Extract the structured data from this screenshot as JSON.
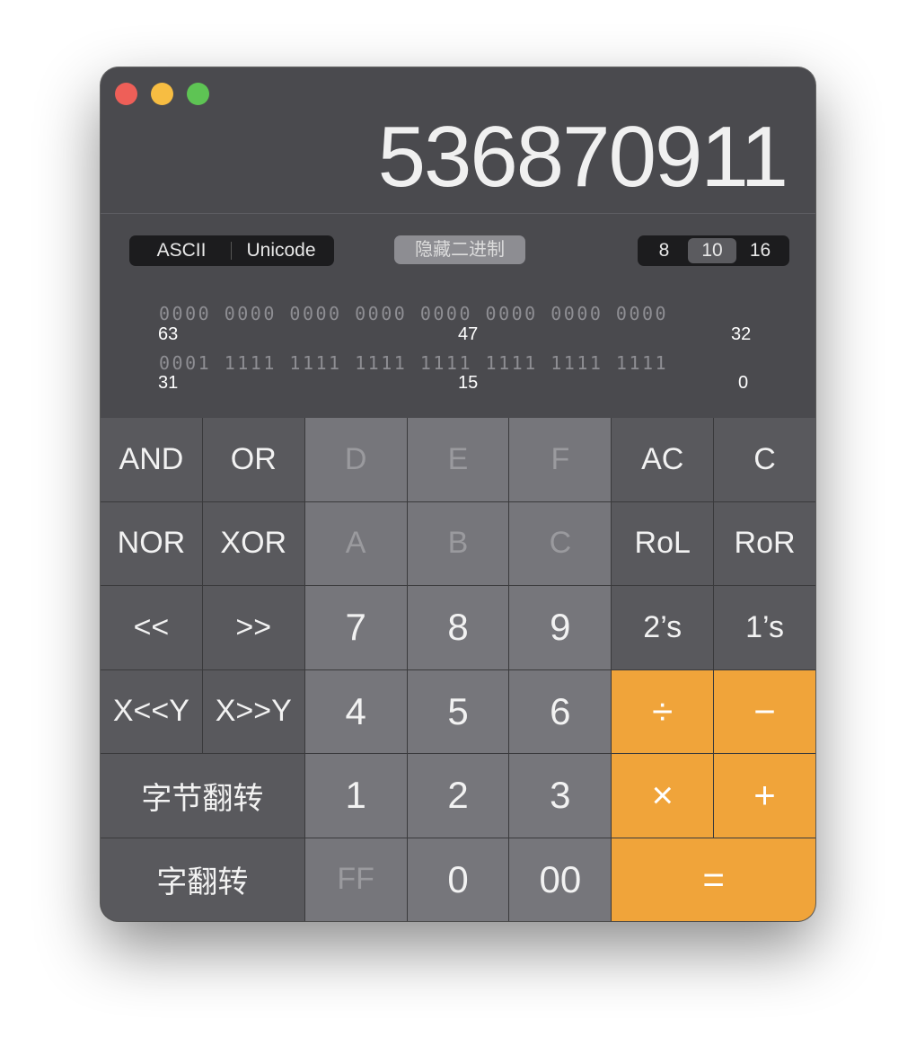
{
  "display": {
    "value": "536870911"
  },
  "encoding": {
    "ascii": "ASCII",
    "unicode": "Unicode"
  },
  "hide_binary_label": "隐藏二进制",
  "base": {
    "options": [
      "8",
      "10",
      "16"
    ],
    "selected": "10"
  },
  "bits": {
    "row1": "0000 0000 0000 0000 0000 0000 0000 0000",
    "row2": "0001 1111 1111 1111 1111 1111 1111 1111",
    "row1_labels": {
      "left": "63",
      "mid": "47",
      "right": "32"
    },
    "row2_labels": {
      "left": "31",
      "mid": "15",
      "right": "0"
    }
  },
  "keys": {
    "and": "AND",
    "or": "OR",
    "d": "D",
    "e": "E",
    "f": "F",
    "ac": "AC",
    "c_clear": "C",
    "nor": "NOR",
    "xor": "XOR",
    "a": "A",
    "b": "B",
    "c_hex": "C",
    "rol": "RoL",
    "ror": "RoR",
    "shl": "<<",
    "shr": ">>",
    "seven": "7",
    "eight": "8",
    "nine": "9",
    "twos": "2’s",
    "ones": "1’s",
    "xshly": "X<<Y",
    "xshry": "X>>Y",
    "four": "4",
    "five": "5",
    "six": "6",
    "divide": "÷",
    "minus": "−",
    "byte_flip": "字节翻转",
    "one": "1",
    "two": "2",
    "three": "3",
    "multiply": "×",
    "plus": "+",
    "word_flip": "字翻转",
    "ff": "FF",
    "zero": "0",
    "double_zero": "00",
    "equals": "="
  },
  "colors": {
    "accent": "#f0a43a",
    "window": "#4a4a4e"
  }
}
